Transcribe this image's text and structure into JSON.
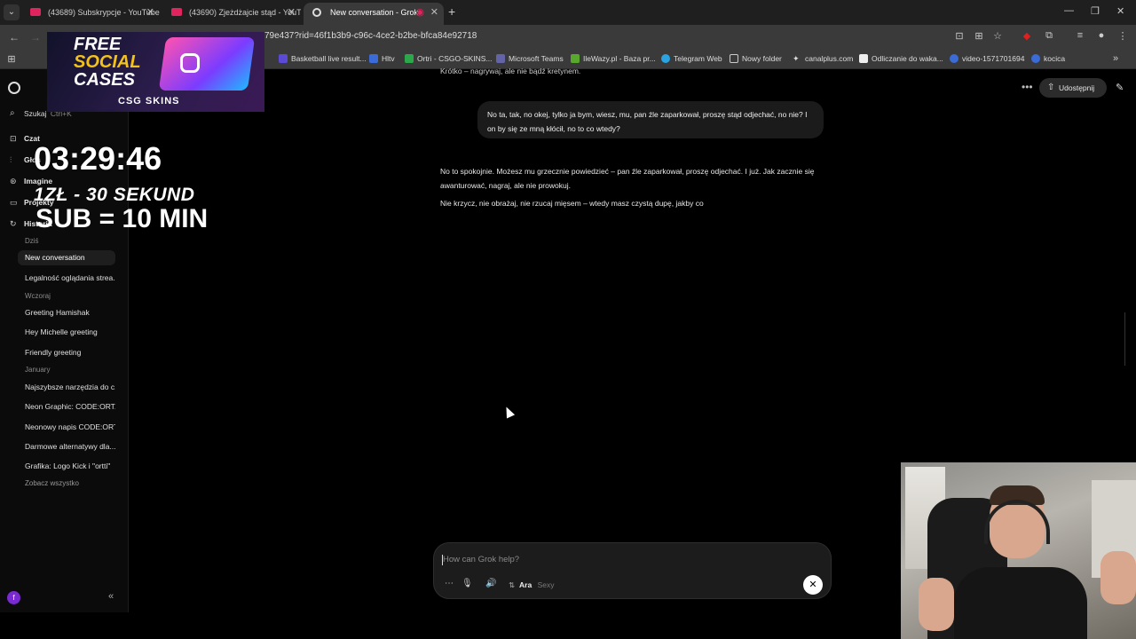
{
  "browser": {
    "tabs": [
      {
        "title": "(43689) Subskrypcje - YouTube",
        "active": false,
        "favicon_color": "#e0245e"
      },
      {
        "title": "(43690) Zjeżdżajcie stąd - YouTube",
        "active": false,
        "favicon_color": "#e0245e"
      },
      {
        "title": "New conversation - Grok",
        "active": true,
        "favicon_color": "#dddddd"
      }
    ],
    "url": "79e437?rid=46f1b3b9-c96c-4ce2-b2be-bfca84e92718",
    "bookmarks": [
      {
        "label": "Basketball live result...",
        "color": "#5a4ad6"
      },
      {
        "label": "Hltv",
        "color": "#3b6bd6"
      },
      {
        "label": "Ortri - CSGO-SKINS...",
        "color": "#2aa84a"
      },
      {
        "label": "Microsoft Teams",
        "color": "#6264a7"
      },
      {
        "label": "IleWazy.pl - Baza pr...",
        "color": "#58a82e"
      },
      {
        "label": "Telegram Web",
        "color": "#2aa3e0"
      },
      {
        "label": "Nowy folder",
        "color": "#cccccc"
      },
      {
        "label": "canalplus.com",
        "color": "#dddddd"
      },
      {
        "label": "Odliczanie do waka...",
        "color": "#eeeeee"
      },
      {
        "label": "video-1571701694",
        "color": "#3b6bd6"
      },
      {
        "label": "kocica",
        "color": "#3b6bd6"
      }
    ]
  },
  "ad": {
    "line1": "FREE",
    "line2": "SOCIAL",
    "line3": "CASES",
    "brand": "CSG SKINS"
  },
  "overlay": {
    "timer": "03:29:46",
    "rate1": "1ZŁ - 30 SEKUND",
    "rate2": "SUB = 10 MIN"
  },
  "sidebar": {
    "search_label": "Szukaj",
    "search_hint": "Ctrl+K",
    "nav": [
      {
        "label": "Czat",
        "icon": "chat-icon"
      },
      {
        "label": "Głos",
        "icon": "voice-icon"
      },
      {
        "label": "Imagine",
        "icon": "image-icon"
      },
      {
        "label": "Projekty",
        "icon": "folder-icon"
      },
      {
        "label": "Historia",
        "icon": "history-icon"
      }
    ],
    "sections": [
      {
        "title": "Dziś",
        "items": [
          "New conversation",
          "Legalność oglądania strea..."
        ]
      },
      {
        "title": "Wczoraj",
        "items": [
          "Greeting Hamishak",
          "Hey Michelle greeting",
          "Friendly greeting"
        ]
      },
      {
        "title": "January",
        "items": [
          "Najszybsze narzędzia do c...",
          "Neon Graphic: CODE:ORT...",
          "Neonowy napis CODE:ORT...",
          "Darmowe alternatywy dla...",
          "Grafika: Logo Kick i \"ortti\""
        ]
      }
    ],
    "see_all": "Zobacz wszystko",
    "avatar_letter": "f"
  },
  "header": {
    "share_label": "Udostępnij"
  },
  "chat": {
    "cut_line": "Krótko – nagrywaj, ale nie bądź kretynem.",
    "user_message": "No ta, tak, no okej, tylko ja bym, wiesz, mu, pan źle zaparkował, proszę stąd odjechać, no nie? I on by się ze mną kłócił, no to co wtedy?",
    "ai_paragraph1": "No to spokojnie. Możesz mu grzecznie powiedzieć – pan źle zaparkował, proszę odjechać. I już. Jak zacznie się awanturować, nagraj, ale nie prowokuj.",
    "ai_paragraph2": "Nie krzycz, nie obrażaj, nie rzucaj mięsem – wtedy masz czystą dupę, jakby co"
  },
  "input": {
    "placeholder": "How can Grok help?",
    "voice_name": "Ara",
    "voice_style": "Sexy"
  }
}
